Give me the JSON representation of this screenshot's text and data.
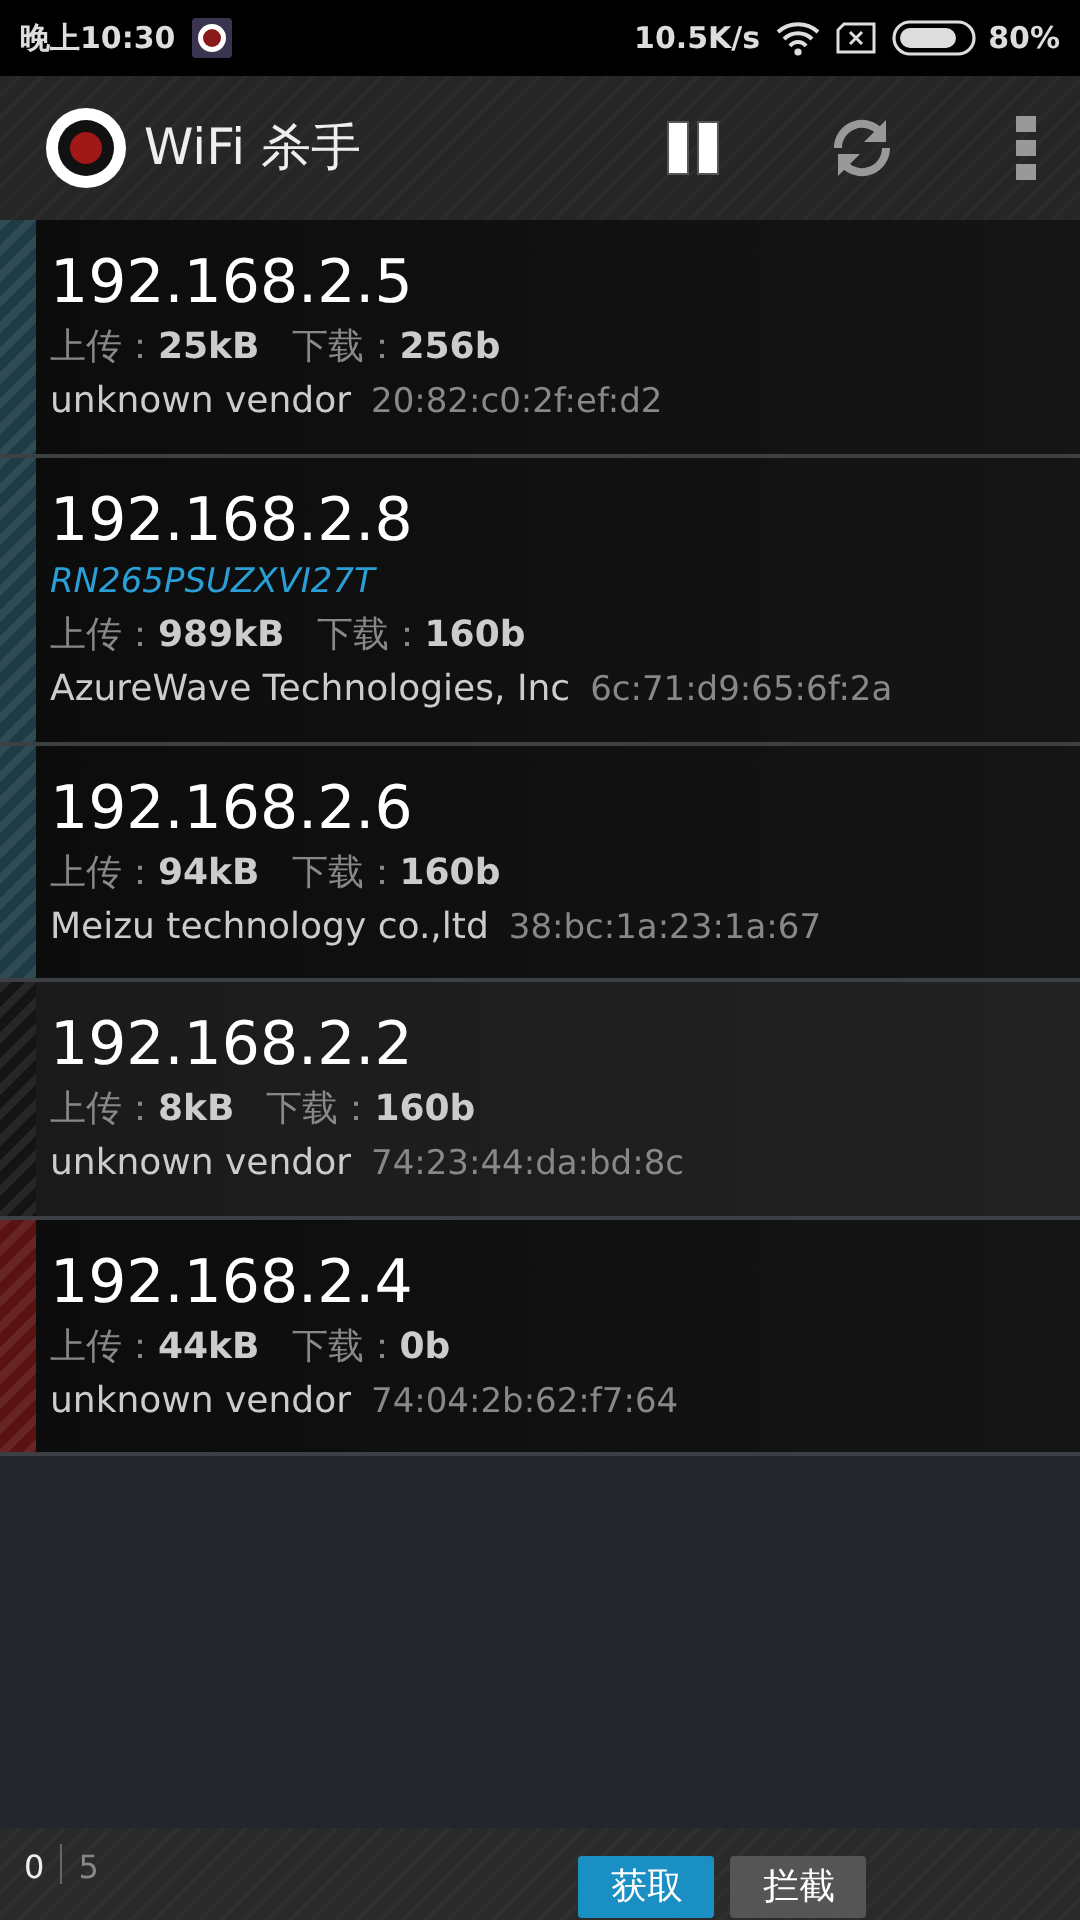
{
  "status_bar": {
    "time": "晚上10:30",
    "speed": "10.5K/s",
    "battery": "80%"
  },
  "app_bar": {
    "title": "WiFi 杀手"
  },
  "devices": [
    {
      "ip": "192.168.2.5",
      "upload_label": "上传：",
      "upload": "25kB",
      "download_label": "下载：",
      "download": "256b",
      "vendor": "unknown vendor",
      "mac": "20:82:c0:2f:ef:d2",
      "color": "#1e3c46"
    },
    {
      "ip": "192.168.2.8",
      "hostname": "RN265PSUZXVI27T",
      "upload_label": "上传：",
      "upload": "989kB",
      "download_label": "下载：",
      "download": "160b",
      "vendor": "AzureWave Technologies, Inc",
      "mac": "6c:71:d9:65:6f:2a",
      "color": "#1e3c46"
    },
    {
      "ip": "192.168.2.6",
      "upload_label": "上传：",
      "upload": "94kB",
      "download_label": "下载：",
      "download": "160b",
      "vendor": "Meizu technology co.,ltd",
      "mac": "38:bc:1a:23:1a:67",
      "color": "#1e3c46"
    },
    {
      "ip": "192.168.2.2",
      "upload_label": "上传：",
      "upload": "8kB",
      "download_label": "下载：",
      "download": "160b",
      "vendor": "unknown vendor",
      "mac": "74:23:44:da:bd:8c",
      "color": "#141414"
    },
    {
      "ip": "192.168.2.4",
      "upload_label": "上传：",
      "upload": "44kB",
      "download_label": "下载：",
      "download": "0b",
      "vendor": "unknown vendor",
      "mac": "74:04:2b:62:f7:64",
      "color": "#5a1212"
    }
  ],
  "footer": {
    "selected_count": "0",
    "total_count": "5",
    "buttons": [
      {
        "label": "获取",
        "selected": true
      },
      {
        "label": "拦截",
        "selected": false
      }
    ]
  }
}
